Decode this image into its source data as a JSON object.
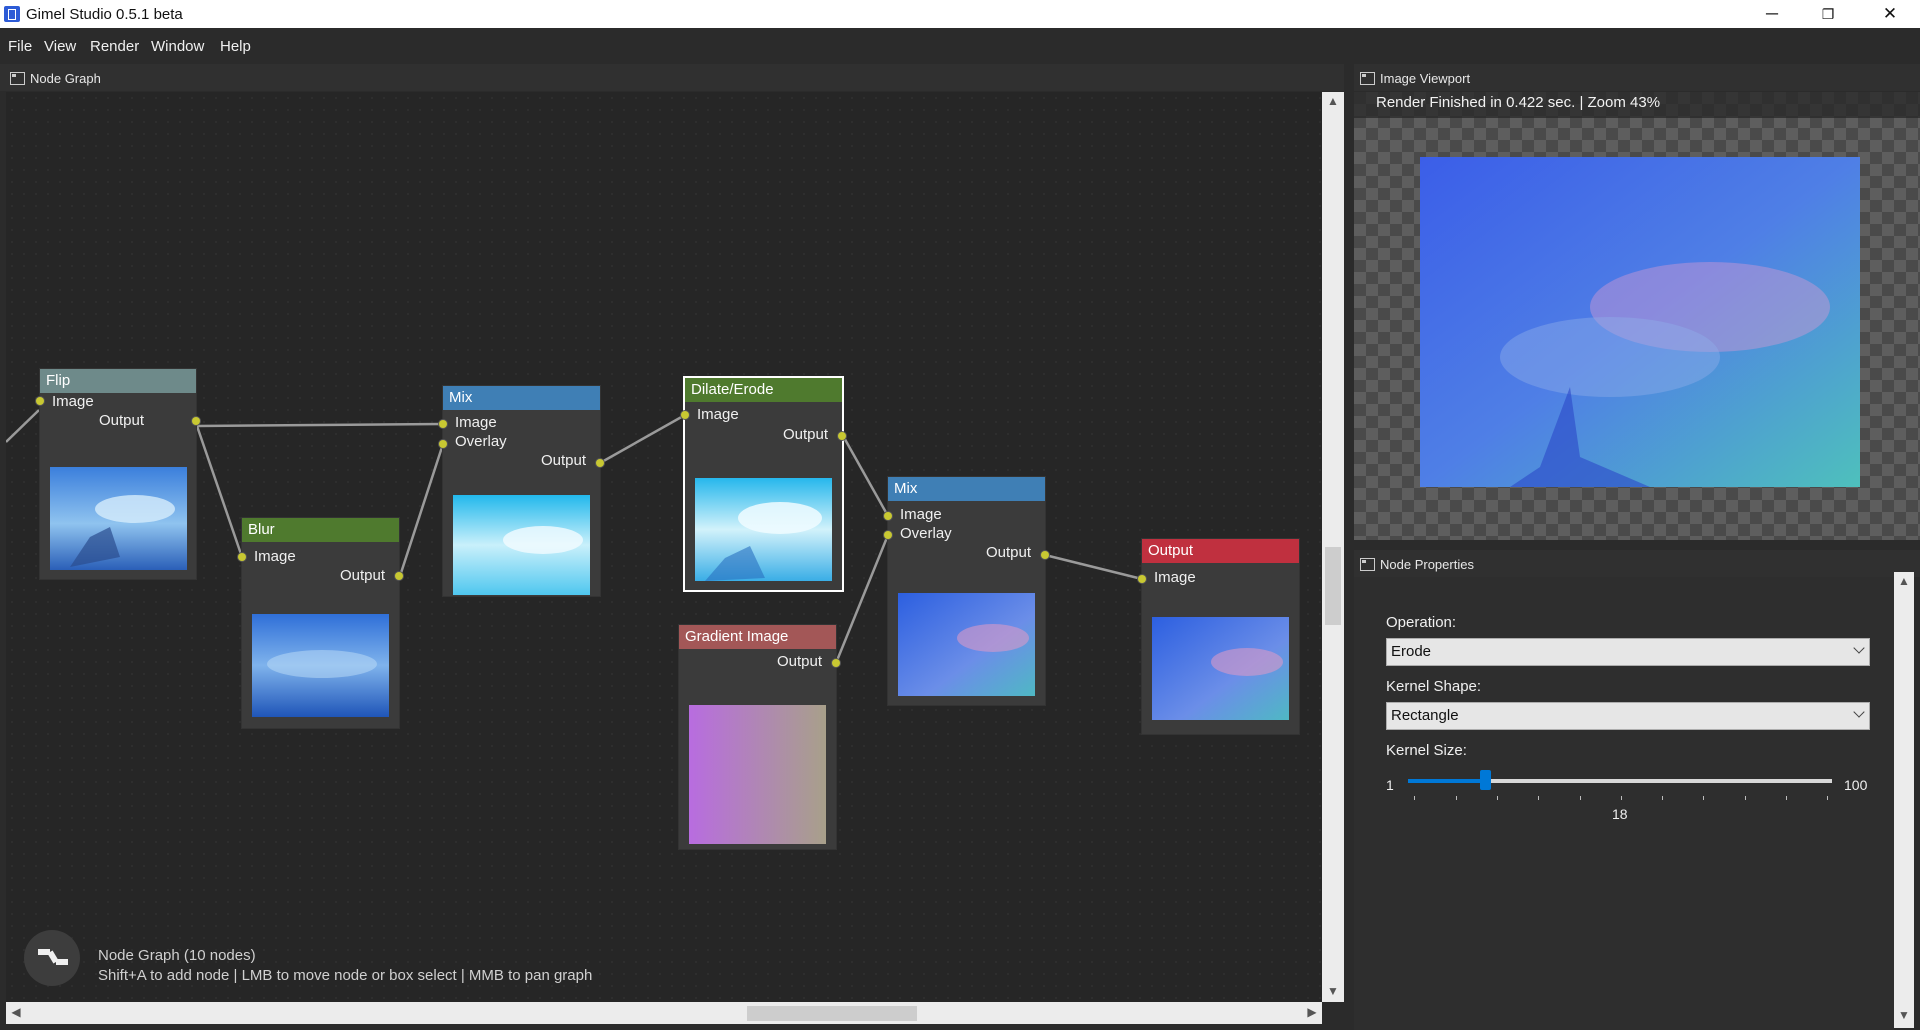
{
  "window": {
    "title": "Gimel Studio 0.5.1 beta",
    "controls": {
      "minimize": "─",
      "restore": "❐",
      "close": "✕"
    }
  },
  "menu": [
    "File",
    "View",
    "Render",
    "Window",
    "Help"
  ],
  "node_graph": {
    "panel_title": "Node Graph",
    "nodes": {
      "flip": {
        "title": "Flip",
        "color": "#6e8a8a",
        "inputs": [
          "Image"
        ],
        "output": "Output"
      },
      "blur": {
        "title": "Blur",
        "color": "#4f7a2e",
        "inputs": [
          "Image"
        ],
        "output": "Output"
      },
      "mix1": {
        "title": "Mix",
        "color": "#3f7fb5",
        "inputs": [
          "Image",
          "Overlay"
        ],
        "output": "Output"
      },
      "dilate": {
        "title": "Dilate/Erode",
        "color": "#4f7a2e",
        "inputs": [
          "Image"
        ],
        "output": "Output",
        "selected": true
      },
      "gradient": {
        "title": "Gradient Image",
        "color": "#a35757",
        "output": "Output"
      },
      "mix2": {
        "title": "Mix",
        "color": "#3f7fb5",
        "inputs": [
          "Image",
          "Overlay"
        ],
        "output": "Output"
      },
      "output": {
        "title": "Output",
        "color": "#c0303f",
        "inputs": [
          "Image"
        ]
      }
    },
    "status": {
      "title": "Node Graph (10 nodes)",
      "hint": "Shift+A to add node | LMB to move node or box select | MMB to pan graph"
    }
  },
  "image_viewport": {
    "panel_title": "Image Viewport",
    "status": "Render Finished in 0.422 sec. | Zoom 43%"
  },
  "node_properties": {
    "panel_title": "Node Properties",
    "operation_label": "Operation:",
    "operation_value": "Erode",
    "kernel_shape_label": "Kernel Shape:",
    "kernel_shape_value": "Rectangle",
    "kernel_size_label": "Kernel Size:",
    "kernel_size": {
      "min": "1",
      "max": "100",
      "value": "18"
    }
  },
  "colors": {
    "accent": "#0078d7",
    "port": "#c8c832",
    "canvas": "#262626"
  }
}
